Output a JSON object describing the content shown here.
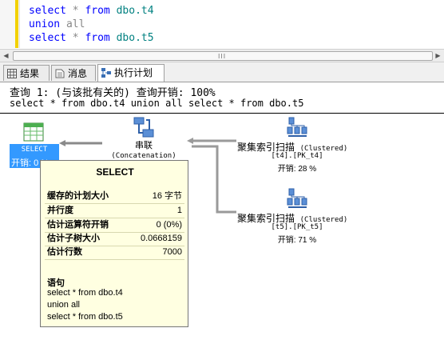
{
  "editor": {
    "lines": [
      {
        "a": "select",
        "b": "*",
        "c": "from",
        "d": "dbo.t4"
      },
      {
        "a": "union",
        "b": "",
        "c": "all",
        "d": ""
      },
      {
        "a": "select",
        "b": "*",
        "c": "from",
        "d": "dbo.t5"
      }
    ]
  },
  "scrollbar": {
    "grip": "III"
  },
  "tabs": [
    {
      "label": "结果",
      "icon": "grid-icon"
    },
    {
      "label": "消息",
      "icon": "message-icon"
    },
    {
      "label": "执行计划",
      "icon": "plan-icon"
    }
  ],
  "plan": {
    "header": "查询 1: (与该批有关的) 查询开销: 100%",
    "sql": "select * from dbo.t4 union all select * from dbo.t5",
    "select_node": {
      "label": "SELECT",
      "cost": "开销: 0 %"
    },
    "concat_node": {
      "label": "串联",
      "sub": "(Concatenation)"
    },
    "scan1": {
      "label": "聚集索引扫描",
      "label_en": "(Clustered)",
      "object": "[t4].[PK_t4]",
      "cost": "开销: 28 %"
    },
    "scan2": {
      "label": "聚集索引扫描",
      "label_en": "(Clustered)",
      "object": "[t5].[PK_t5]",
      "cost": "开销: 71 %"
    }
  },
  "tooltip": {
    "title": "SELECT",
    "rows": [
      {
        "key": "缓存的计划大小",
        "value": "16 字节"
      },
      {
        "key": "并行度",
        "value": "1"
      },
      {
        "key": "估计运算符开销",
        "value": "0 (0%)"
      },
      {
        "key": "估计子树大小",
        "value": "0.0668159"
      },
      {
        "key": "估计行数",
        "value": "7000"
      }
    ],
    "statement_header": "语句",
    "statement": [
      "select * from dbo.t4",
      "union all",
      "select * from dbo.t5"
    ]
  },
  "colors": {
    "select_highlight": "#3399ff",
    "tooltip_bg": "#ffffe1",
    "keyword": "#0000ff"
  }
}
